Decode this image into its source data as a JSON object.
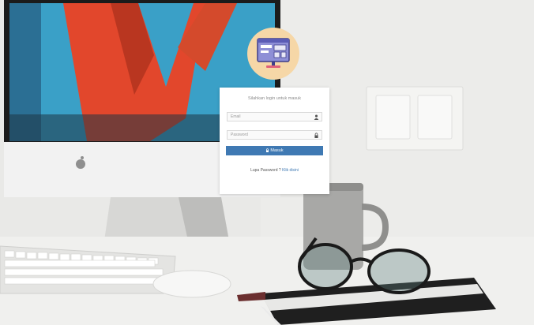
{
  "login": {
    "title": "Silahkan login untuk masuk",
    "email": {
      "placeholder": "Email",
      "value": ""
    },
    "password": {
      "placeholder": "Password",
      "value": ""
    },
    "submit_label": "Masuk",
    "lost_password_label": "Lupa Password ?",
    "lost_password_link": "Klik disini"
  },
  "icons": {
    "logo": "monitor-dashboard-icon",
    "email_field": "user-icon",
    "password_field": "lock-icon",
    "submit": "login-icon"
  },
  "colors": {
    "primary": "#3f79b3",
    "logo_badge": "#f6d7a7"
  }
}
